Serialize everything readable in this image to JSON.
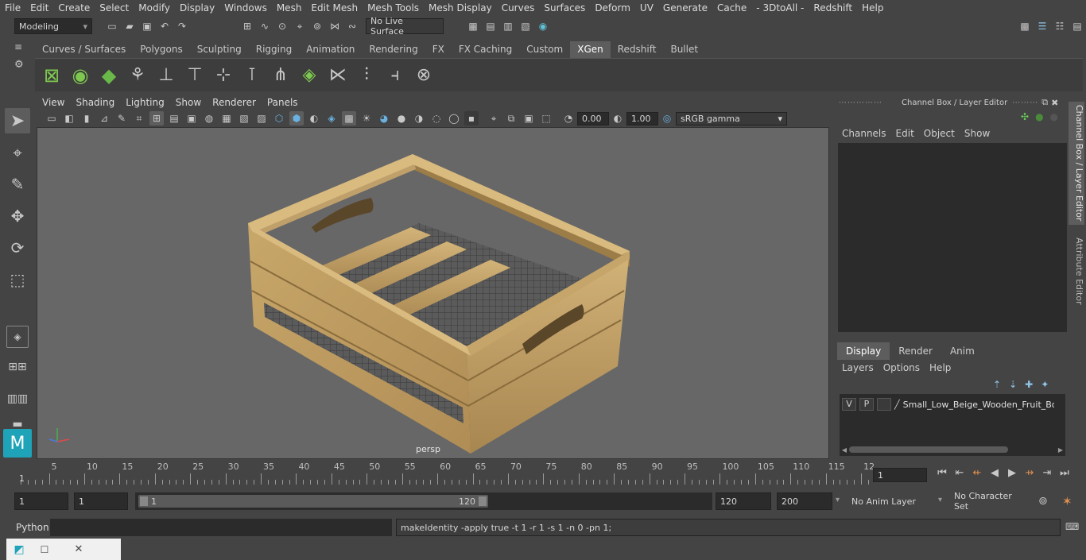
{
  "menubar": {
    "items": [
      "File",
      "Edit",
      "Create",
      "Select",
      "Modify",
      "Display",
      "Windows",
      "Mesh",
      "Edit Mesh",
      "Mesh Tools",
      "Mesh Display",
      "Curves",
      "Surfaces",
      "Deform",
      "UV",
      "Generate",
      "Cache",
      "- 3DtoAll -",
      "Redshift",
      "Help"
    ]
  },
  "statusline": {
    "mode": "Modeling",
    "live_surface": "No Live Surface"
  },
  "shelf": {
    "tabs": [
      "Curves / Surfaces",
      "Polygons",
      "Sculpting",
      "Rigging",
      "Animation",
      "Rendering",
      "FX",
      "FX Caching",
      "Custom",
      "XGen",
      "Redshift",
      "Bullet"
    ],
    "active_tab": "XGen"
  },
  "viewport": {
    "menus": [
      "View",
      "Shading",
      "Lighting",
      "Show",
      "Renderer",
      "Panels"
    ],
    "exposure": "0.00",
    "gamma": "1.00",
    "color_space": "sRGB gamma",
    "camera_label": "persp",
    "object": "Small_Low_Beige_Wooden_Fruit_Box"
  },
  "channel_box": {
    "title": "Channel Box / Layer Editor",
    "menus": [
      "Channels",
      "Edit",
      "Object",
      "Show"
    ]
  },
  "layer_editor": {
    "tabs": [
      "Display",
      "Render",
      "Anim"
    ],
    "active_tab": "Display",
    "menus": [
      "Layers",
      "Options",
      "Help"
    ],
    "layer": {
      "v": "V",
      "p": "P",
      "name": "Small_Low_Beige_Wooden_Fruit_Box"
    }
  },
  "side_tabs": {
    "channel": "Channel Box / Layer Editor",
    "attribute": "Attribute Editor"
  },
  "timeline": {
    "ticks": [
      "5",
      "10",
      "15",
      "20",
      "25",
      "30",
      "35",
      "40",
      "45",
      "50",
      "55",
      "60",
      "65",
      "70",
      "75",
      "80",
      "85",
      "90",
      "95",
      "100",
      "105",
      "110",
      "115",
      "12"
    ],
    "start_label": "1",
    "current_frame": "1"
  },
  "range": {
    "start": "1",
    "current": "1",
    "slider_start": "1",
    "slider_end": "120",
    "end": "120",
    "max": "200",
    "anim_layer": "No Anim Layer",
    "character_set": "No Character Set"
  },
  "cmdline": {
    "lang": "Python",
    "output": "makeIdentity -apply true -t 1 -r 1 -s 1 -n 0 -pn 1;"
  },
  "colors": {
    "accent": "#5d5d5d",
    "wood": "#c9a86c",
    "viewport_bg": "#676767"
  }
}
